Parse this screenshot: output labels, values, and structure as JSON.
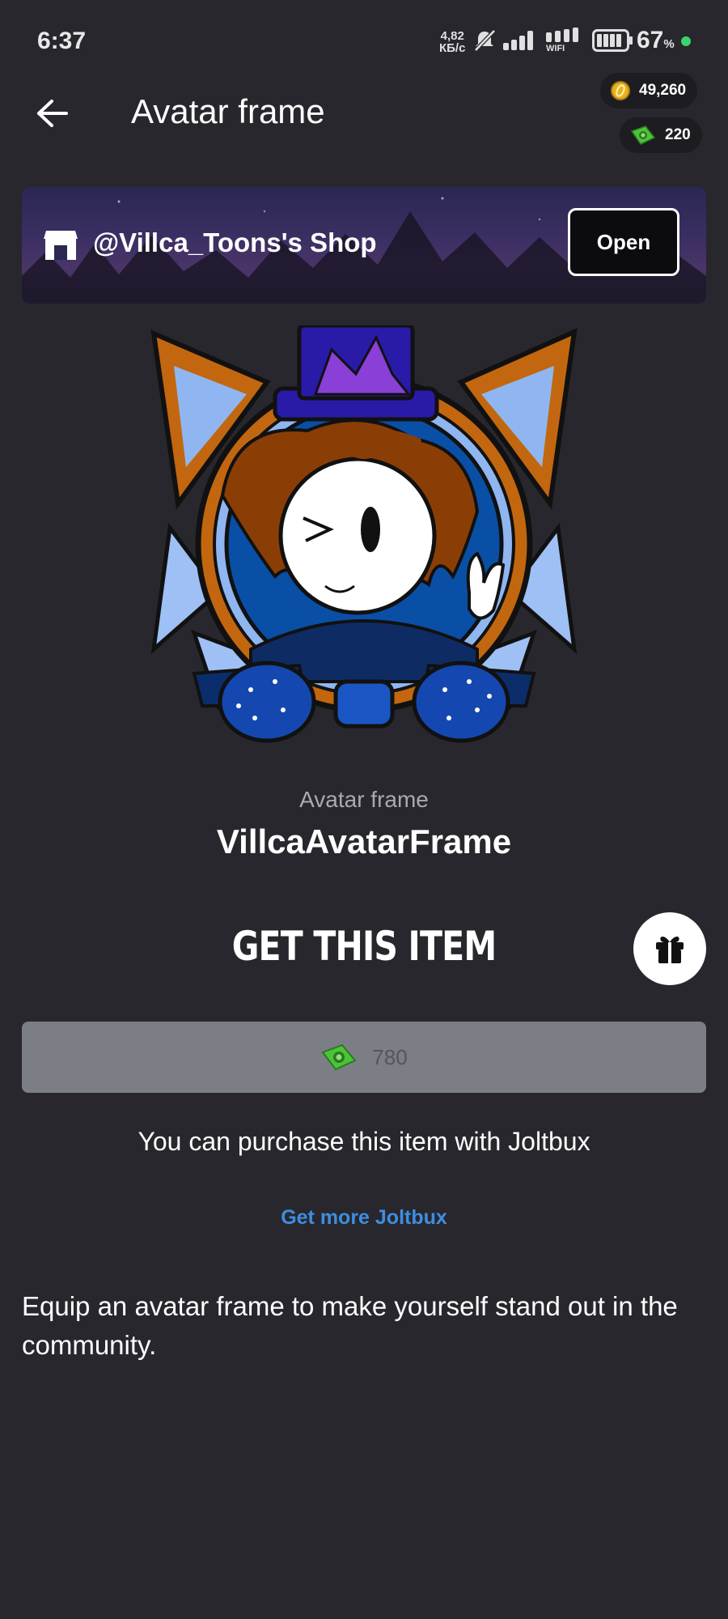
{
  "status_bar": {
    "time": "6:37",
    "net_speed_value": "4,82",
    "net_speed_unit": "КБ/с",
    "wifi_label": "WIFI",
    "battery_percent": "67",
    "battery_symbol": "%"
  },
  "header": {
    "title": "Avatar frame",
    "coins": "49,260",
    "joltbux": "220"
  },
  "shop": {
    "name": "@Villca_Toons's Shop",
    "open_label": "Open"
  },
  "item": {
    "type": "Avatar frame",
    "name": "VillcaAvatarFrame"
  },
  "purchase": {
    "heading": "GET THIS ITEM",
    "price": "780",
    "note": "You can purchase this item with Joltbux",
    "get_more_label": "Get more Joltbux"
  },
  "description": "Equip an avatar frame to make yourself stand out in the community.",
  "colors": {
    "background": "#28272d",
    "link": "#3d8ee0",
    "price_bar": "#7c7e85",
    "coin": "#e6b422",
    "joltbux": "#4cc43a"
  }
}
